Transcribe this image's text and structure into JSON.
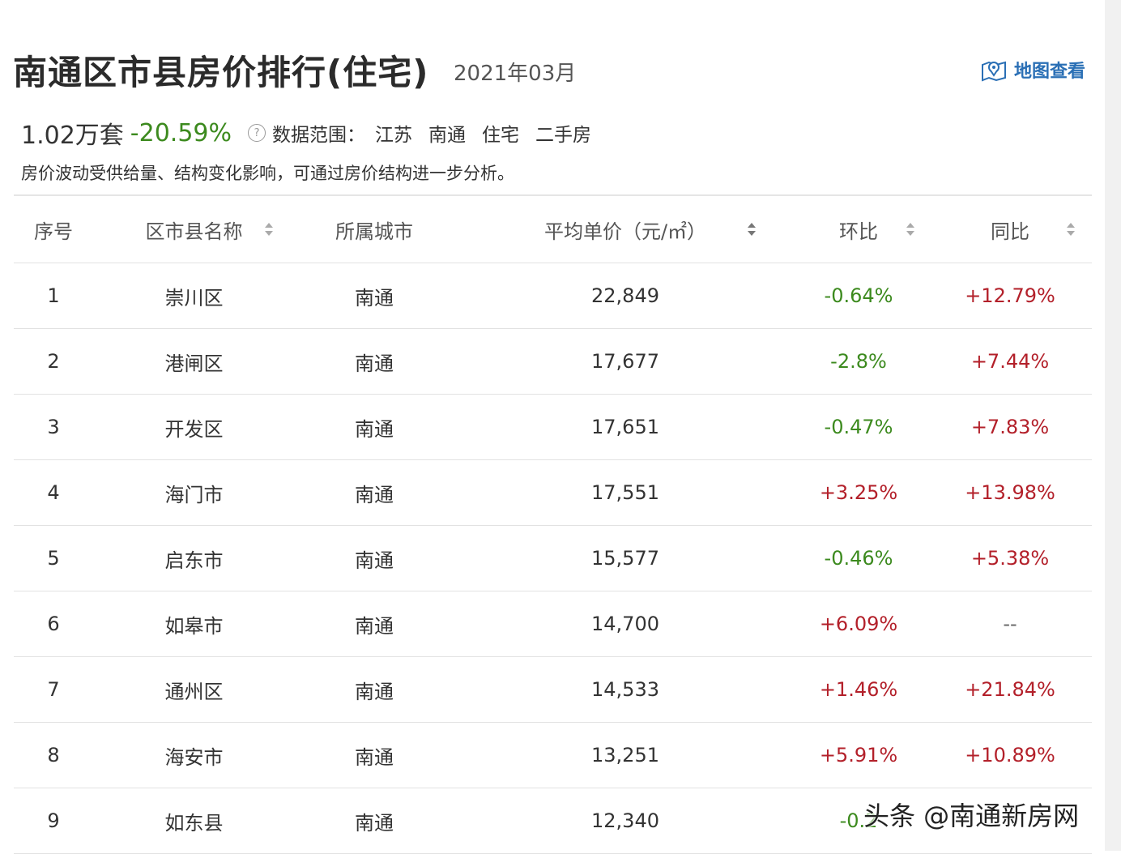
{
  "header": {
    "title": "南通区市县房价排行(住宅)",
    "date": "2021年03月",
    "map_link": "地图查看"
  },
  "stats": {
    "volume": "1.02万套",
    "change": "-20.59%",
    "scope_label": "数据范围：",
    "scope": [
      "江苏",
      "南通",
      "住宅",
      "二手房"
    ]
  },
  "note": "房价波动受供给量、结构变化影响，可通过房价结构进一步分析。",
  "table": {
    "headers": [
      "序号",
      "区市县名称",
      "所属城市",
      "平均单价（元/㎡）",
      "环比",
      "同比"
    ],
    "rows": [
      {
        "rank": "1",
        "name": "崇川区",
        "city": "南通",
        "price": "22,849",
        "mom": "-0.64%",
        "yoy": "+12.79%"
      },
      {
        "rank": "2",
        "name": "港闸区",
        "city": "南通",
        "price": "17,677",
        "mom": "-2.8%",
        "yoy": "+7.44%"
      },
      {
        "rank": "3",
        "name": "开发区",
        "city": "南通",
        "price": "17,651",
        "mom": "-0.47%",
        "yoy": "+7.83%"
      },
      {
        "rank": "4",
        "name": "海门市",
        "city": "南通",
        "price": "17,551",
        "mom": "+3.25%",
        "yoy": "+13.98%"
      },
      {
        "rank": "5",
        "name": "启东市",
        "city": "南通",
        "price": "15,577",
        "mom": "-0.46%",
        "yoy": "+5.38%"
      },
      {
        "rank": "6",
        "name": "如皋市",
        "city": "南通",
        "price": "14,700",
        "mom": "+6.09%",
        "yoy": "--"
      },
      {
        "rank": "7",
        "name": "通州区",
        "city": "南通",
        "price": "14,533",
        "mom": "+1.46%",
        "yoy": "+21.84%"
      },
      {
        "rank": "8",
        "name": "海安市",
        "city": "南通",
        "price": "13,251",
        "mom": "+5.91%",
        "yoy": "+10.89%"
      },
      {
        "rank": "9",
        "name": "如东县",
        "city": "南通",
        "price": "12,340",
        "mom": "-0.2",
        "yoy": ""
      }
    ]
  },
  "watermark": "头条 @南通新房网",
  "colors": {
    "down": "#3c8a1e",
    "up": "#b3202a",
    "link": "#2a6fb5"
  }
}
